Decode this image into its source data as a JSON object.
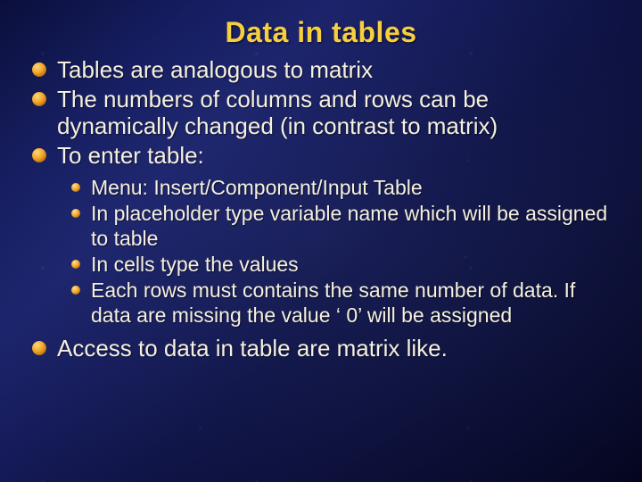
{
  "title": "Data in tables",
  "bullets_top_1": "Tables are analogous to matrix",
  "bullets_top_2": "The numbers of columns and rows can be dynamically changed (in contrast to matrix)",
  "bullets_top_3": "To enter table:",
  "sub_1": "Menu: Insert/Component/Input Table",
  "sub_2": "In placeholder type variable name which will be assigned to table",
  "sub_3": "In cells type the values",
  "sub_4": "Each rows must contains the same number of data. If data are missing the value ‘ 0’ will be assigned",
  "bullets_top_4": "Access to data in table are matrix like."
}
